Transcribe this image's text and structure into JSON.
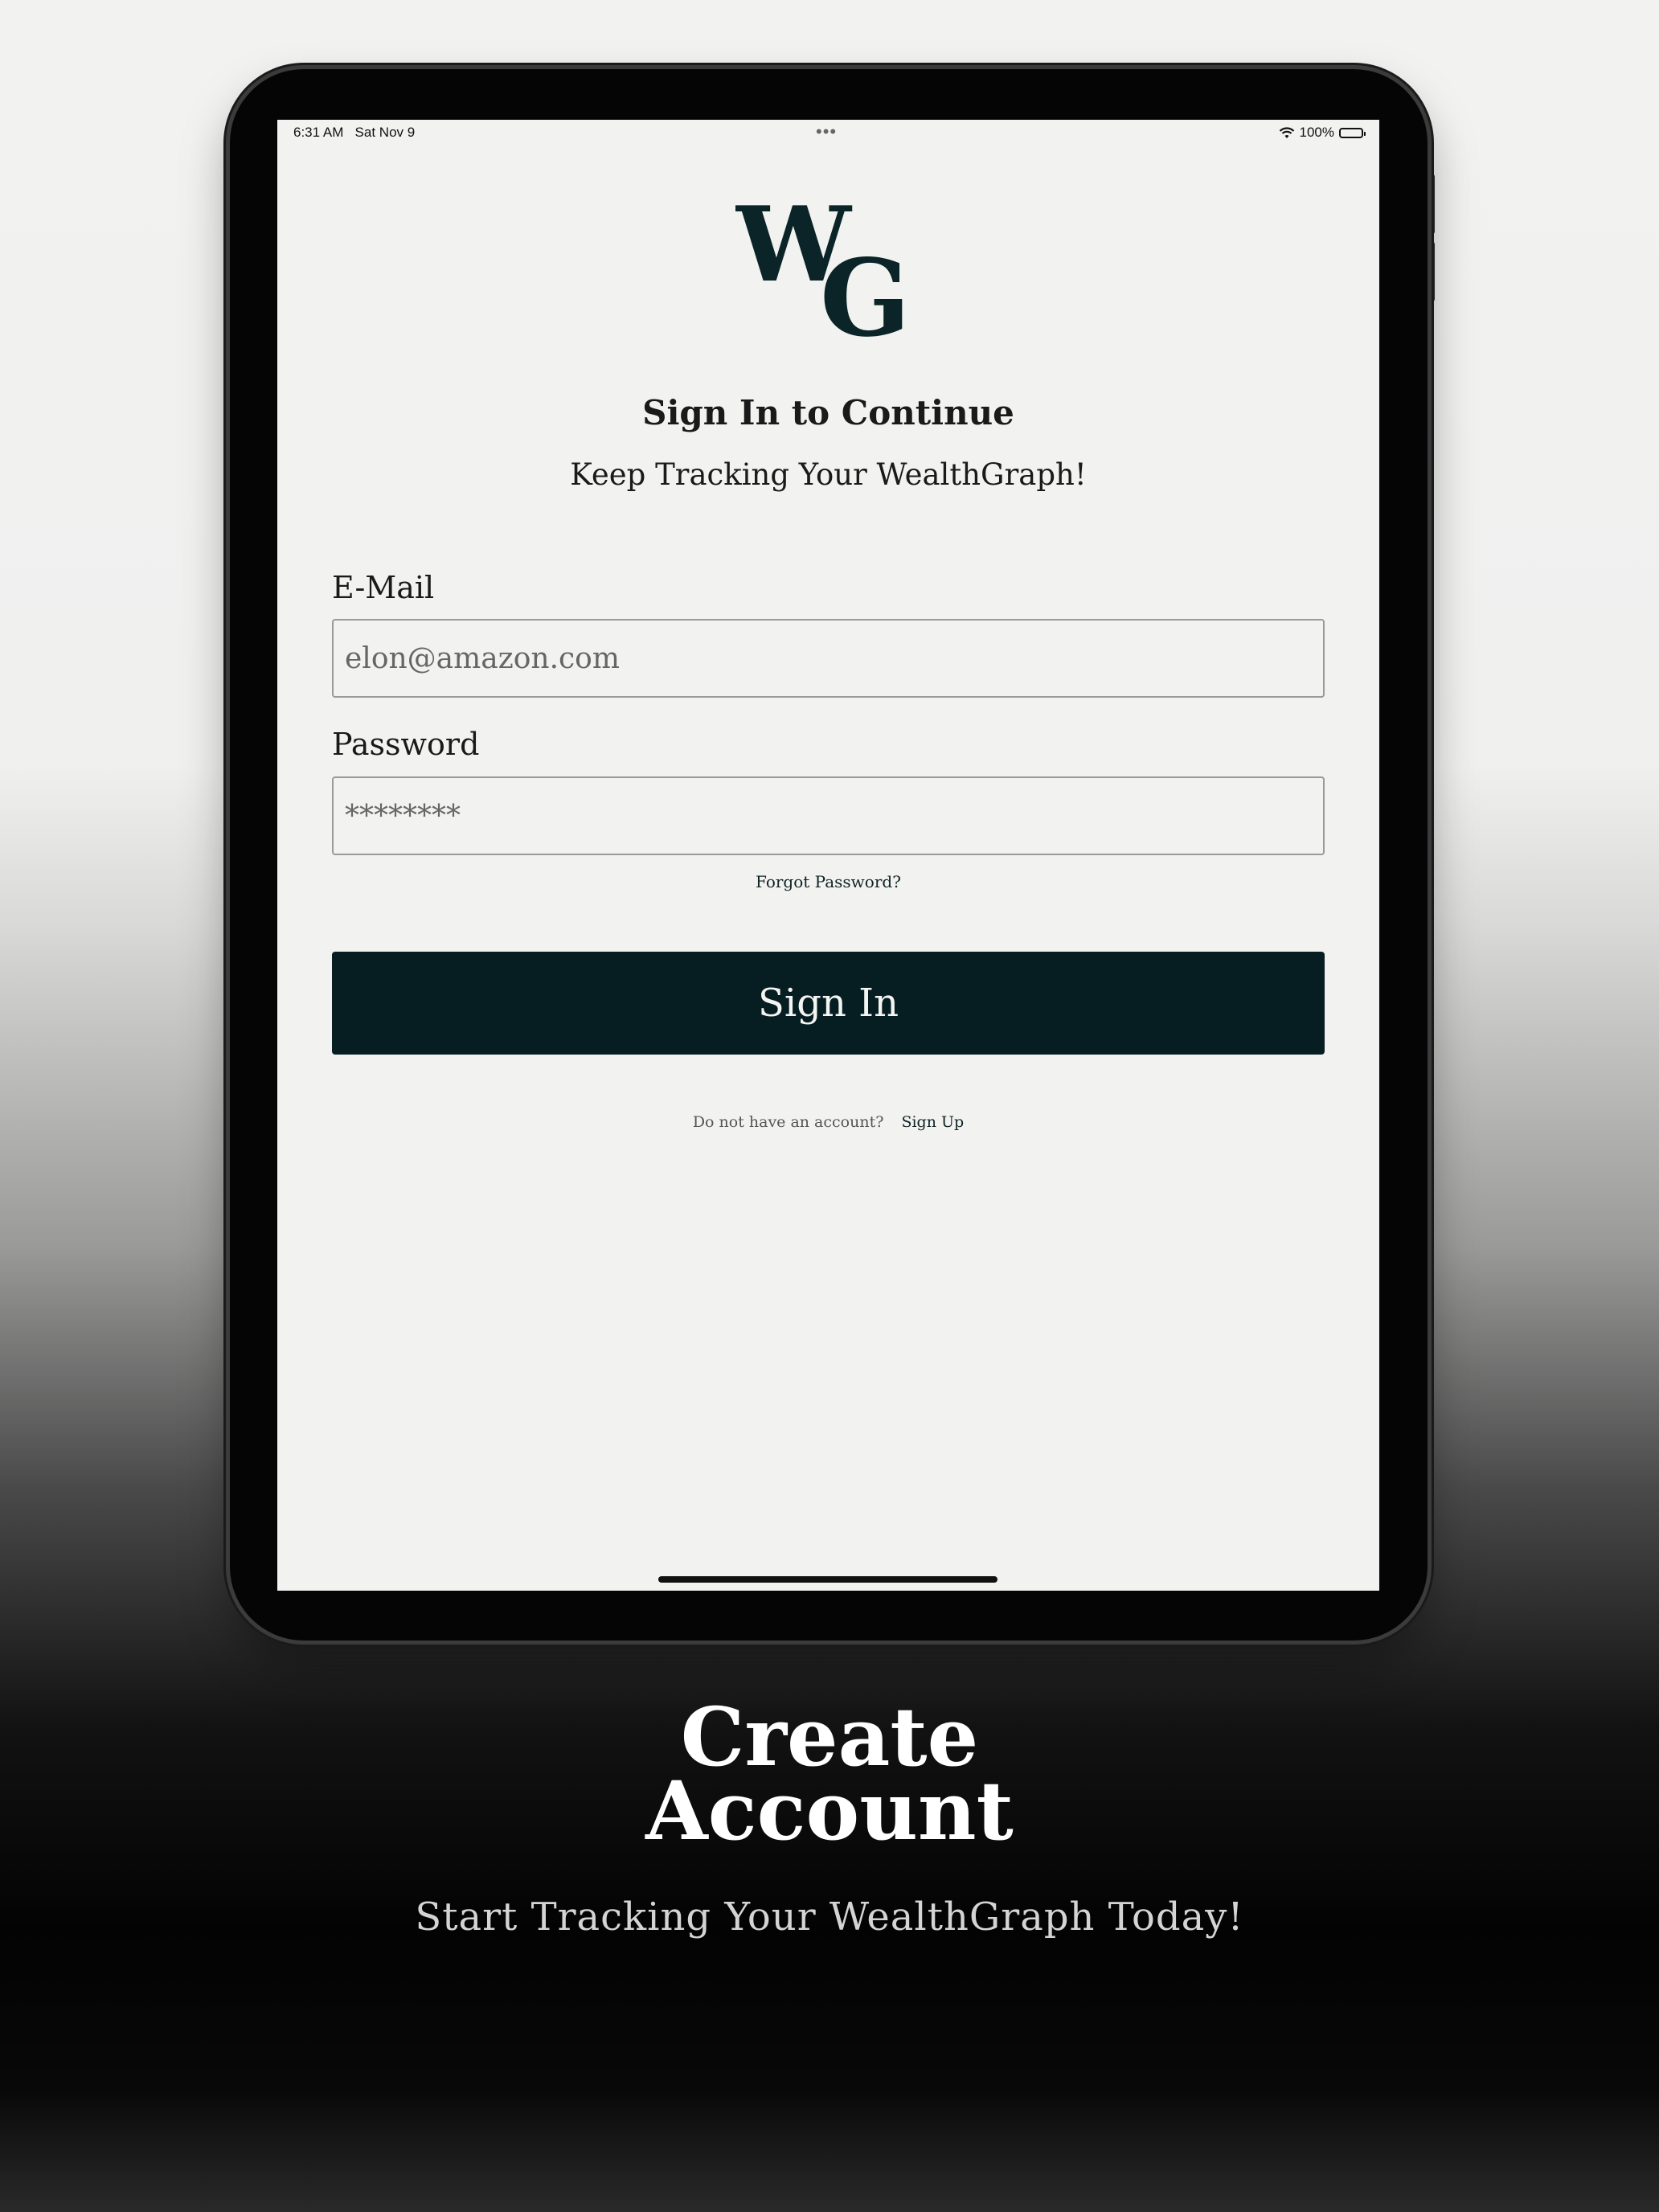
{
  "status_bar": {
    "time": "6:31 AM",
    "date": "Sat Nov 9",
    "dots": "•••",
    "battery": "100%"
  },
  "logo": {
    "letter1": "W",
    "letter2": "G",
    "color": "#0b2427"
  },
  "header": {
    "title": "Sign In to Continue",
    "subtitle": "Keep Tracking Your WealthGraph!"
  },
  "form": {
    "email_label": "E-Mail",
    "email_placeholder": "elon@amazon.com",
    "password_label": "Password",
    "password_placeholder": "********",
    "forgot_label": "Forgot Password?",
    "signin_label": "Sign In",
    "no_account_text": "Do not have an account?",
    "signup_label": "Sign Up"
  },
  "promo": {
    "title_line1": "Create",
    "title_line2": "Account",
    "subtitle": "Start Tracking Your WealthGraph Today!"
  },
  "colors": {
    "primary": "#061e22",
    "screen_bg": "#f2f2f0",
    "promo_text": "#ffffff"
  }
}
